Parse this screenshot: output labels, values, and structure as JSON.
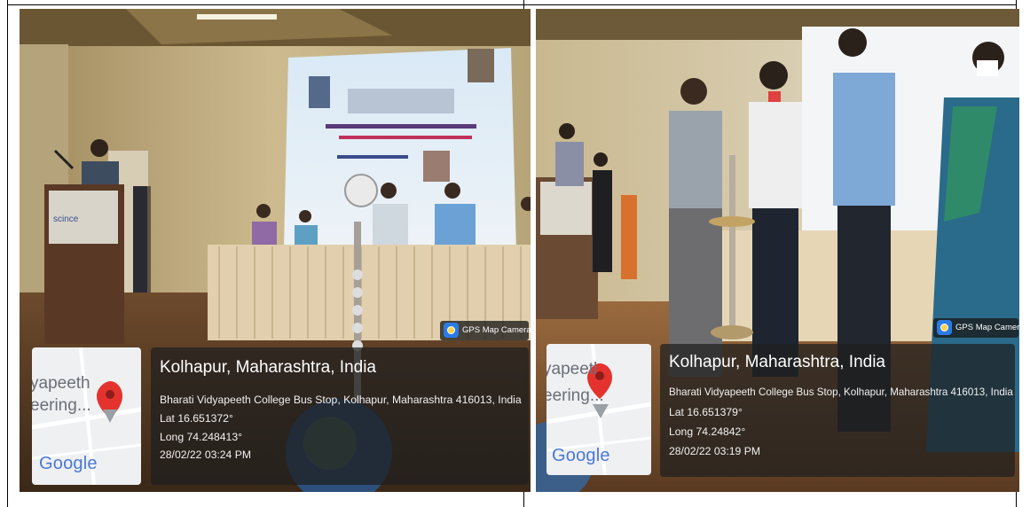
{
  "photos": [
    {
      "gps_badge": "GPS Map Camera",
      "map_snippet_top": "yapeeth",
      "map_snippet_bottom": "eering...",
      "map_brand": "Google",
      "location_title": "Kolhapur, Maharashtra, India",
      "address": "Bharati Vidyapeeth College Bus Stop, Kolhapur, Maharashtra 416013, India",
      "latitude": "Lat 16.651372°",
      "longitude": "Long 74.248413°",
      "datetime": "28/02/22 03:24 PM"
    },
    {
      "gps_badge": "GPS Map Camera",
      "map_snippet_top": "yapeetl",
      "map_snippet_bottom": "eering...",
      "map_brand": "Google",
      "location_title": "Kolhapur, Maharashtra, India",
      "address": "Bharati Vidyapeeth College Bus Stop, Kolhapur, Maharashtra 416013, India",
      "latitude": "Lat 16.651379°",
      "longitude": "Long 74.24842°",
      "datetime": "28/02/22 03:19 PM"
    }
  ],
  "colors": {
    "overlay": "#1e1e1e",
    "map_pin": "#e4332e",
    "badge_icon": "#2c7be5"
  }
}
